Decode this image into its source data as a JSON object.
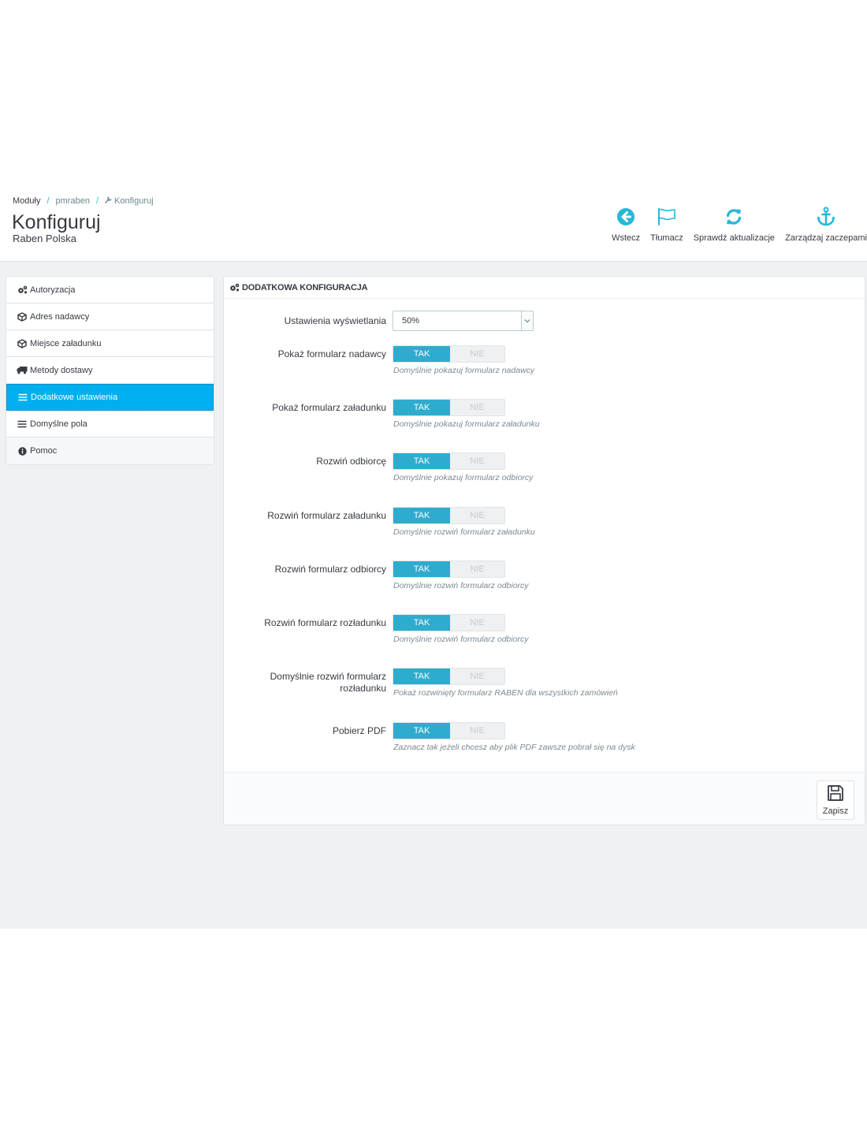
{
  "breadcrumb": {
    "item1": "Moduły",
    "item2": "pmraben",
    "item3": "Konfiguruj",
    "separator": "/"
  },
  "header": {
    "title": "Konfiguruj",
    "subtitle": "Raben Polska"
  },
  "toolbar": {
    "back": {
      "label": "Wstecz",
      "icon": "arrow-left-circle-icon"
    },
    "translate": {
      "label": "Tłumacz",
      "icon": "flag-icon"
    },
    "updates": {
      "label": "Sprawdź aktualizacje",
      "icon": "refresh-icon"
    },
    "hooks": {
      "label": "Zarządzaj zaczepami",
      "icon": "anchor-icon"
    },
    "accent_color": "#25b9d7"
  },
  "sidebar": {
    "items": [
      {
        "label": "Autoryzacja",
        "icon": "cogs-icon",
        "active": false
      },
      {
        "label": "Adres nadawcy",
        "icon": "cube-icon",
        "active": false
      },
      {
        "label": "Miejsce załadunku",
        "icon": "cube-icon",
        "active": false
      },
      {
        "label": "Metody dostawy",
        "icon": "truck-icon",
        "active": false
      },
      {
        "label": "Dodatkowe ustawienia",
        "icon": "list-icon",
        "active": true
      },
      {
        "label": "Domyślne pola",
        "icon": "list-icon",
        "active": false
      },
      {
        "label": "Pomoc",
        "icon": "info-circle-icon",
        "active": false
      }
    ],
    "active_color": "#00aff0"
  },
  "panel": {
    "heading": "DODATKOWA KONFIGURACJA",
    "display_setting": {
      "label": "Ustawienia wyświetlania",
      "value": "50%"
    },
    "toggle_on_label": "TAK",
    "toggle_off_label": "NIE",
    "toggles": [
      {
        "label": "Pokaż formularz nadawcy",
        "help": "Domyślnie pokazuj formularz nadawcy",
        "value": "TAK"
      },
      {
        "label": "Pokaż formularz załadunku",
        "help": "Domyślnie pokazuj formularz załadunku",
        "value": "TAK"
      },
      {
        "label": "Rozwiń odbiorcę",
        "help": "Domyślnie pokazuj formularz odbiorcy",
        "value": "TAK"
      },
      {
        "label": "Rozwiń formularz załadunku",
        "help": "Domyślnie rozwiń formularz załadunku",
        "value": "TAK"
      },
      {
        "label": "Rozwiń formularz odbiorcy",
        "help": "Domyślnie rozwiń formularz odbiorcy",
        "value": "TAK"
      },
      {
        "label": "Rozwiń formularz rozładunku",
        "help": "Domyślnie rozwiń formularz odbiorcy",
        "value": "TAK"
      },
      {
        "label_line1": "Domyślnie rozwiń formularz",
        "label_line2": "rozładunku",
        "help": "Pokaż rozwinięty formularz RABEN dla wszystkich zamówień",
        "value": "TAK"
      },
      {
        "label": "Pobierz PDF",
        "help": "Zaznacz tak jeżeli chcesz aby plik PDF zawsze pobrał się na dysk",
        "value": "TAK"
      }
    ],
    "toggle_on_color": "#2eacce",
    "save_label": "Zapisz"
  }
}
